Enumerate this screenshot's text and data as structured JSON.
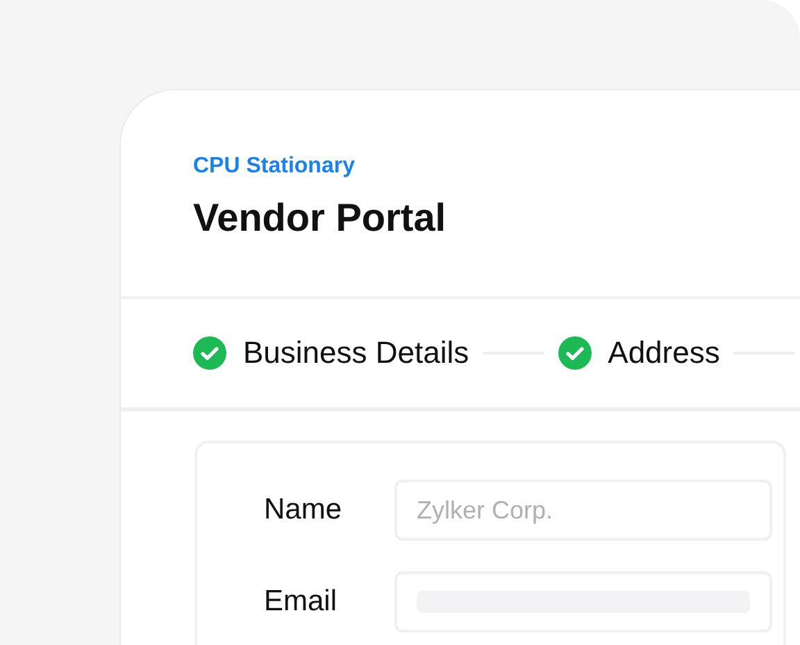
{
  "portal": {
    "organization": "CPU Stationary",
    "title": "Vendor Portal"
  },
  "steps": [
    {
      "label": "Business Details",
      "completed": true
    },
    {
      "label": "Address",
      "completed": true
    }
  ],
  "form": {
    "fields": [
      {
        "label": "Name",
        "placeholder": "Zylker Corp.",
        "kind": "text"
      },
      {
        "label": "Email",
        "kind": "skeleton"
      }
    ]
  }
}
